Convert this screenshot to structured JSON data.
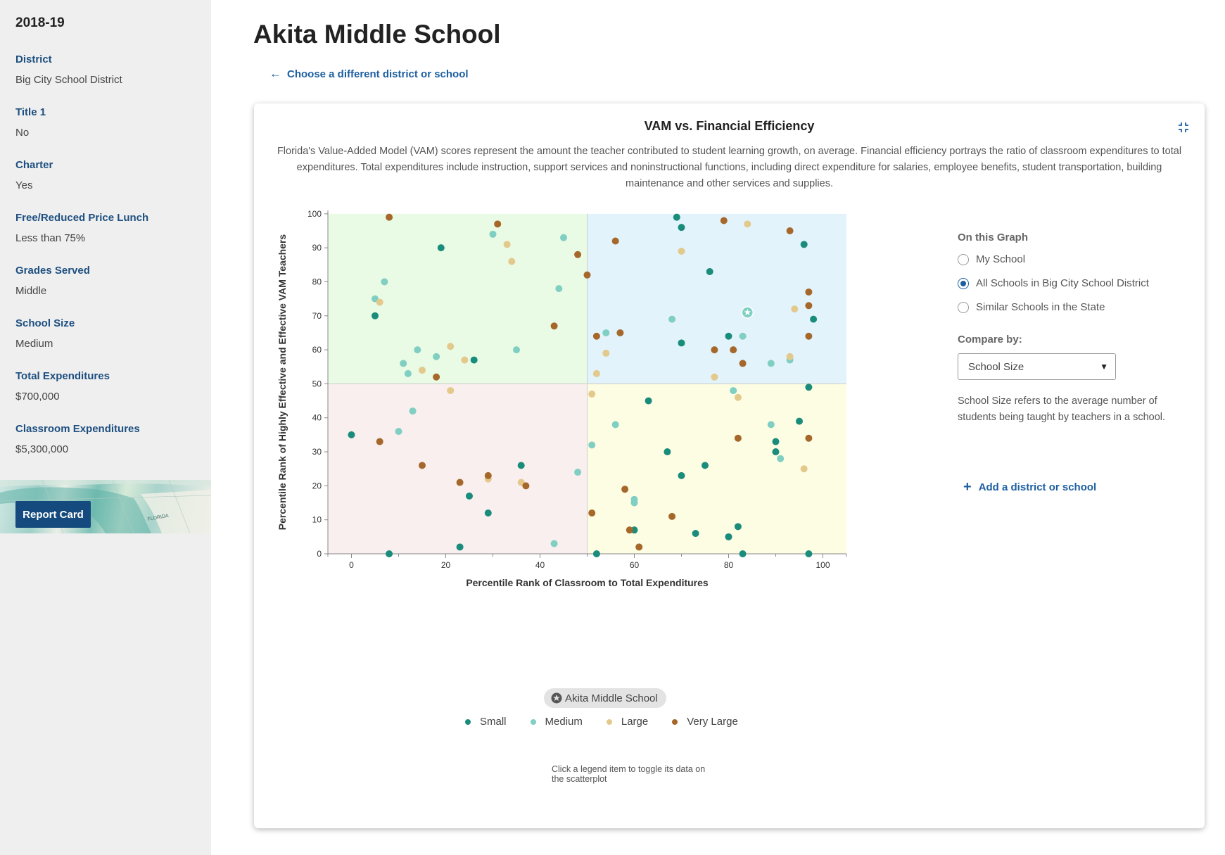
{
  "sidebar": {
    "year": "2018-19",
    "fields": [
      {
        "label": "District",
        "value": "Big City School District"
      },
      {
        "label": "Title 1",
        "value": "No"
      },
      {
        "label": "Charter",
        "value": "Yes"
      },
      {
        "label": "Free/Reduced Price Lunch",
        "value": "Less than 75%"
      },
      {
        "label": "Grades Served",
        "value": "Middle"
      },
      {
        "label": "School Size",
        "value": "Medium"
      },
      {
        "label": "Total Expenditures",
        "value": "$700,000"
      },
      {
        "label": "Classroom Expenditures",
        "value": "$5,300,000"
      }
    ],
    "report_card_label": "Report Card",
    "banner_map_text": "FLORIDA"
  },
  "header": {
    "title": "Akita Middle School",
    "back_link": "Choose a different district or school",
    "back_icon": "arrow-left-icon"
  },
  "card": {
    "title": "VAM vs. Financial Efficiency",
    "collapse_icon": "collapse-icon",
    "description": "Florida's Value-Added Model (VAM) scores represent the amount the teacher contributed to student learning growth, on average. Financial efficiency portrays the ratio of classroom expenditures to total expenditures. Total expenditures include instruction, support services and noninstructional functions, including direct expenditure for salaries, employee benefits, student transportation, building maintenance and other services and supplies."
  },
  "controls": {
    "graph_heading": "On this Graph",
    "radio_options": [
      {
        "label": "My School",
        "checked": false
      },
      {
        "label": "All Schools in Big City School District",
        "checked": true
      },
      {
        "label": "Similar Schools in the State",
        "checked": false
      }
    ],
    "compare_heading": "Compare by:",
    "compare_selected": "School Size",
    "compare_description": "School Size refers to the average number of students being taught by teachers in a school.",
    "add_link": "Add a district or school",
    "add_icon": "plus-icon"
  },
  "legend": {
    "highlight_school": "Akita Middle School",
    "highlight_icon": "star-icon",
    "items": [
      {
        "label": "Small",
        "color": "#1a8c7b"
      },
      {
        "label": "Medium",
        "color": "#80cfc2"
      },
      {
        "label": "Large",
        "color": "#e3c98c"
      },
      {
        "label": "Very Large",
        "color": "#a5682a"
      }
    ],
    "footnote": "Click a legend item to toggle its data on the scatterplot"
  },
  "chart_data": {
    "type": "scatter",
    "title": "VAM vs. Financial Efficiency",
    "xlabel": "Percentile Rank of Classroom to Total Expenditures",
    "ylabel": "Percentile Rank of Highly Effective and Effective VAM Teachers",
    "xlim": [
      -5,
      105
    ],
    "ylim": [
      0,
      101
    ],
    "x_ticks": [
      0,
      20,
      40,
      60,
      80,
      100
    ],
    "y_ticks": [
      0,
      10,
      20,
      30,
      40,
      50,
      60,
      70,
      80,
      90,
      100
    ],
    "quadrant_split": {
      "x": 50,
      "y": 50
    },
    "quadrant_colors": {
      "top_left": "#e9fbe4",
      "top_right": "#e2f3fb",
      "bottom_left": "#f9efee",
      "bottom_right": "#fdfde3"
    },
    "grid": false,
    "legend_position": "bottom",
    "highlight": {
      "name": "Akita Middle School",
      "series": "Medium",
      "x": 84,
      "y": 71
    },
    "series": [
      {
        "name": "Small",
        "color": "#1a8c7b",
        "points": [
          [
            0,
            35
          ],
          [
            5,
            70
          ],
          [
            8,
            0
          ],
          [
            19,
            90
          ],
          [
            23,
            2
          ],
          [
            25,
            17
          ],
          [
            26,
            57
          ],
          [
            29,
            12
          ],
          [
            36,
            26
          ],
          [
            52,
            0
          ],
          [
            60,
            7
          ],
          [
            63,
            45
          ],
          [
            67,
            30
          ],
          [
            69,
            99
          ],
          [
            70,
            96
          ],
          [
            70,
            23
          ],
          [
            70,
            62
          ],
          [
            73,
            6
          ],
          [
            75,
            26
          ],
          [
            76,
            83
          ],
          [
            80,
            5
          ],
          [
            80,
            64
          ],
          [
            82,
            8
          ],
          [
            83,
            0
          ],
          [
            90,
            33
          ],
          [
            90,
            30
          ],
          [
            95,
            39
          ],
          [
            96,
            91
          ],
          [
            97,
            49
          ],
          [
            97,
            0
          ],
          [
            98,
            69
          ]
        ]
      },
      {
        "name": "Medium",
        "color": "#80cfc2",
        "points": [
          [
            5,
            75
          ],
          [
            7,
            80
          ],
          [
            10,
            36
          ],
          [
            11,
            56
          ],
          [
            12,
            53
          ],
          [
            13,
            42
          ],
          [
            14,
            60
          ],
          [
            18,
            58
          ],
          [
            30,
            94
          ],
          [
            35,
            60
          ],
          [
            43,
            3
          ],
          [
            44,
            78
          ],
          [
            45,
            93
          ],
          [
            48,
            24
          ],
          [
            51,
            32
          ],
          [
            54,
            65
          ],
          [
            56,
            38
          ],
          [
            60,
            16
          ],
          [
            60,
            15
          ],
          [
            68,
            69
          ],
          [
            81,
            48
          ],
          [
            83,
            64
          ],
          [
            89,
            56
          ],
          [
            89,
            38
          ],
          [
            91,
            28
          ],
          [
            93,
            57
          ]
        ]
      },
      {
        "name": "Large",
        "color": "#e3c98c",
        "points": [
          [
            6,
            74
          ],
          [
            15,
            54
          ],
          [
            21,
            61
          ],
          [
            21,
            48
          ],
          [
            24,
            57
          ],
          [
            29,
            22
          ],
          [
            33,
            91
          ],
          [
            34,
            86
          ],
          [
            36,
            21
          ],
          [
            51,
            47
          ],
          [
            52,
            53
          ],
          [
            54,
            59
          ],
          [
            70,
            89
          ],
          [
            77,
            52
          ],
          [
            82,
            46
          ],
          [
            84,
            97
          ],
          [
            93,
            58
          ],
          [
            94,
            72
          ],
          [
            96,
            25
          ]
        ]
      },
      {
        "name": "Very Large",
        "color": "#a5682a",
        "points": [
          [
            6,
            33
          ],
          [
            8,
            99
          ],
          [
            15,
            26
          ],
          [
            18,
            52
          ],
          [
            23,
            21
          ],
          [
            29,
            23
          ],
          [
            31,
            97
          ],
          [
            37,
            20
          ],
          [
            43,
            67
          ],
          [
            48,
            88
          ],
          [
            50,
            82
          ],
          [
            51,
            12
          ],
          [
            52,
            64
          ],
          [
            56,
            92
          ],
          [
            57,
            65
          ],
          [
            58,
            19
          ],
          [
            59,
            7
          ],
          [
            61,
            2
          ],
          [
            68,
            11
          ],
          [
            77,
            60
          ],
          [
            79,
            98
          ],
          [
            81,
            60
          ],
          [
            82,
            34
          ],
          [
            83,
            56
          ],
          [
            93,
            95
          ],
          [
            97,
            77
          ],
          [
            97,
            73
          ],
          [
            97,
            64
          ],
          [
            97,
            34
          ]
        ]
      }
    ]
  }
}
